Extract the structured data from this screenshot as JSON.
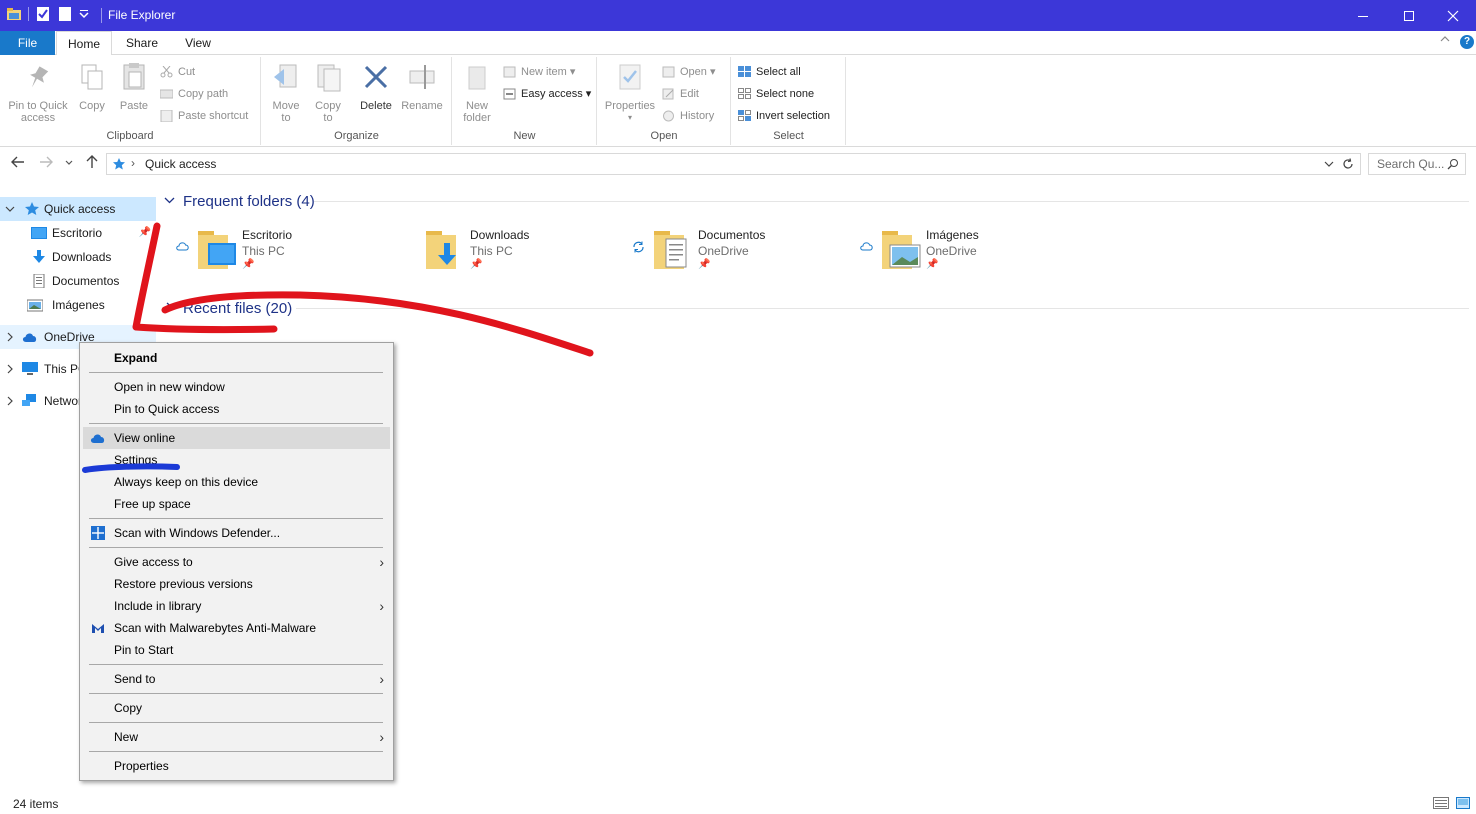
{
  "window": {
    "title": "File Explorer"
  },
  "ribbon_tabs": [
    "File",
    "Home",
    "Share",
    "View"
  ],
  "help_label": "?",
  "ribbon": {
    "clipboard": {
      "label": "Clipboard",
      "pin_line1": "Pin to Quick",
      "pin_line2": "access",
      "copy": "Copy",
      "paste": "Paste",
      "cut": "Cut",
      "copy_path": "Copy path",
      "paste_shortcut": "Paste shortcut"
    },
    "organize": {
      "label": "Organize",
      "move_line1": "Move",
      "move_line2": "to",
      "copy_line1": "Copy",
      "copy_line2": "to",
      "delete": "Delete",
      "rename": "Rename"
    },
    "new": {
      "label": "New",
      "folder_line1": "New",
      "folder_line2": "folder",
      "new_item": "New item",
      "easy_access": "Easy access"
    },
    "open": {
      "label": "Open",
      "properties": "Properties",
      "open": "Open",
      "edit": "Edit",
      "history": "History"
    },
    "select": {
      "label": "Select",
      "select_all": "Select all",
      "select_none": "Select none",
      "invert": "Invert selection"
    }
  },
  "address": {
    "path": "Quick access",
    "search_placeholder": "Search Qu..."
  },
  "nav": {
    "quick_access": "Quick access",
    "items": [
      {
        "label": "Escritorio"
      },
      {
        "label": "Downloads"
      },
      {
        "label": "Documentos"
      },
      {
        "label": "Imágenes"
      }
    ],
    "onedrive": "OneDrive",
    "this_pc": "This PC",
    "network": "Network"
  },
  "main": {
    "frequent_title": "Frequent folders (4)",
    "recent_title": "Recent files (20)",
    "folders": [
      {
        "name": "Escritorio",
        "location": "This PC",
        "status": "cloud"
      },
      {
        "name": "Downloads",
        "location": "This PC",
        "status": "none"
      },
      {
        "name": "Documentos",
        "location": "OneDrive",
        "status": "sync"
      },
      {
        "name": "Imágenes",
        "location": "OneDrive",
        "status": "cloud"
      }
    ]
  },
  "status": {
    "items": "24 items"
  },
  "context_menu": {
    "expand": "Expand",
    "open_new_window": "Open in new window",
    "pin_quick": "Pin to Quick access",
    "view_online": "View online",
    "settings": "Settings",
    "always_keep": "Always keep on this device",
    "free_up": "Free up space",
    "scan_defender": "Scan with Windows Defender...",
    "give_access": "Give access to",
    "restore": "Restore previous versions",
    "include_library": "Include in library",
    "scan_malwarebytes": "Scan with Malwarebytes Anti-Malware",
    "pin_start": "Pin to Start",
    "send_to": "Send to",
    "copy": "Copy",
    "new": "New",
    "properties": "Properties"
  },
  "colors": {
    "titlebar": "#3c37d8",
    "accent": "#1979ca",
    "selection": "#cce8ff",
    "annotation_red": "#e0141c",
    "annotation_blue": "#1b3ad6"
  }
}
